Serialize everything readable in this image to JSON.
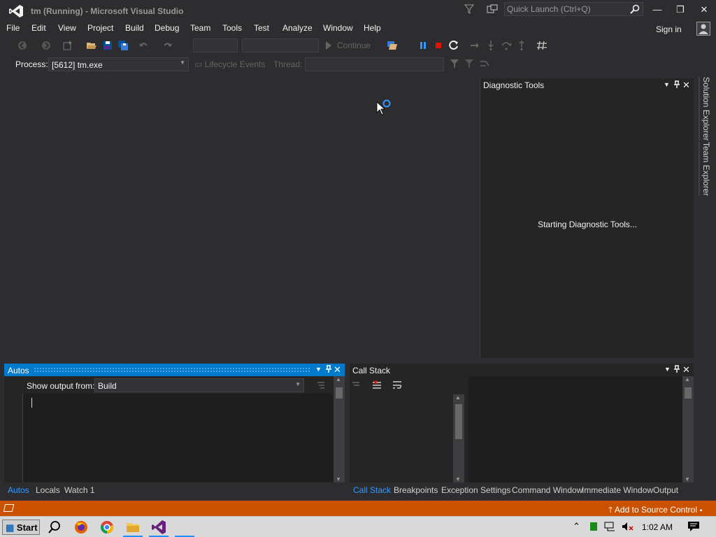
{
  "window": {
    "title": "tm (Running) - Microsoft Visual Studio",
    "quick_launch_placeholder": "Quick Launch (Ctrl+Q)",
    "min_glyph": "—",
    "max_glyph": "❐",
    "close_glyph": "✕"
  },
  "menu": {
    "items": [
      "File",
      "Edit",
      "View",
      "Project",
      "Build",
      "Debug",
      "Team",
      "Tools",
      "Test",
      "Analyze",
      "Window",
      "Help"
    ],
    "sign_in": "Sign in"
  },
  "toolbar": {
    "continue_label": "Continue",
    "icons": [
      "back-icon",
      "forward-icon",
      "new-project-icon",
      "open-file-icon",
      "save-icon",
      "save-all-icon",
      "undo-icon",
      "redo-icon",
      "continue-icon",
      "break-all-icon",
      "stop-icon",
      "restart-icon",
      "show-next-statement-icon",
      "step-into-icon",
      "step-over-icon",
      "step-out-icon",
      "hex-display-icon"
    ]
  },
  "debug_location": {
    "process_label": "Process:",
    "process_value": "[5612] tm.exe",
    "lifecycle_label": "Lifecycle Events",
    "thread_label": "Thread:"
  },
  "diagnostic_tools": {
    "title": "Diagnostic Tools",
    "status": "Starting Diagnostic Tools..."
  },
  "side_tabs": [
    "Solution Explorer",
    "Team Explorer"
  ],
  "autos_panel": {
    "title": "Autos",
    "output_label": "Show output from:",
    "output_source": "Build"
  },
  "call_stack_panel": {
    "title": "Call Stack"
  },
  "autos_tabs": [
    "Autos",
    "Locals",
    "Watch 1"
  ],
  "debug_tabs": [
    "Call Stack",
    "Breakpoints",
    "Exception Settings",
    "Command Window",
    "Immediate Window",
    "Output"
  ],
  "status_bar": {
    "source_control": "Add to Source Control",
    "color": "#ca5100"
  },
  "taskbar": {
    "start_label": "Start",
    "clock": "1:02 AM",
    "apps": [
      "search-icon",
      "firefox-icon",
      "chrome-icon",
      "file-explorer-icon",
      "visual-studio-icon"
    ]
  },
  "colors": {
    "accent": "#007acc",
    "background": "#2d2d30",
    "tab_active": "#3399ff"
  }
}
